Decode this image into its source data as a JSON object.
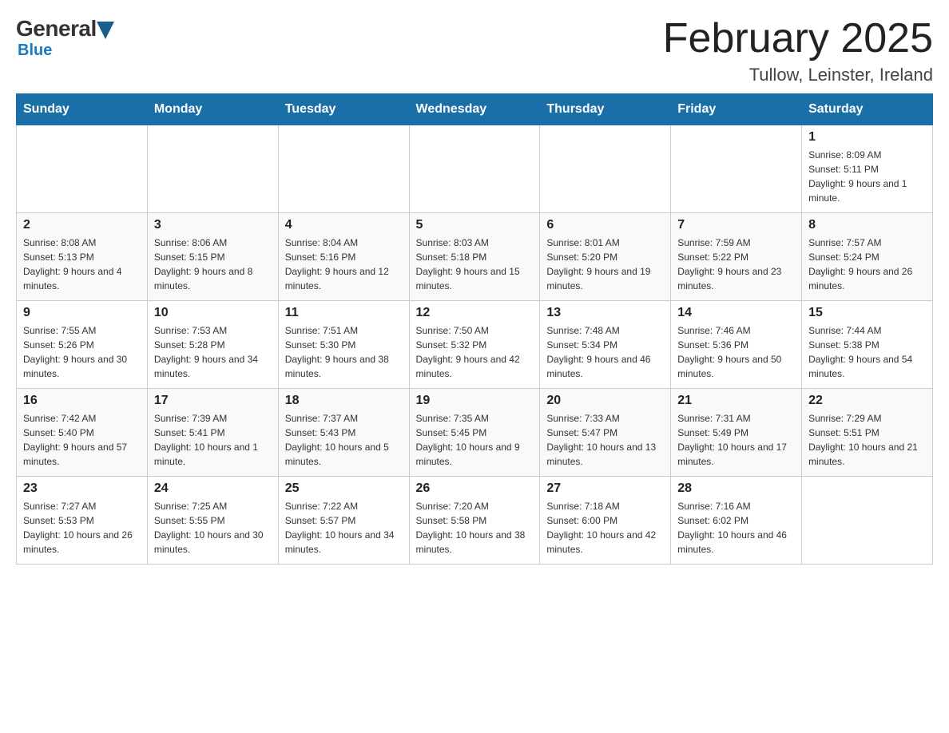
{
  "logo": {
    "general": "General",
    "blue": "Blue"
  },
  "title": "February 2025",
  "location": "Tullow, Leinster, Ireland",
  "days_of_week": [
    "Sunday",
    "Monday",
    "Tuesday",
    "Wednesday",
    "Thursday",
    "Friday",
    "Saturday"
  ],
  "weeks": [
    [
      {
        "day": "",
        "info": ""
      },
      {
        "day": "",
        "info": ""
      },
      {
        "day": "",
        "info": ""
      },
      {
        "day": "",
        "info": ""
      },
      {
        "day": "",
        "info": ""
      },
      {
        "day": "",
        "info": ""
      },
      {
        "day": "1",
        "info": "Sunrise: 8:09 AM\nSunset: 5:11 PM\nDaylight: 9 hours and 1 minute."
      }
    ],
    [
      {
        "day": "2",
        "info": "Sunrise: 8:08 AM\nSunset: 5:13 PM\nDaylight: 9 hours and 4 minutes."
      },
      {
        "day": "3",
        "info": "Sunrise: 8:06 AM\nSunset: 5:15 PM\nDaylight: 9 hours and 8 minutes."
      },
      {
        "day": "4",
        "info": "Sunrise: 8:04 AM\nSunset: 5:16 PM\nDaylight: 9 hours and 12 minutes."
      },
      {
        "day": "5",
        "info": "Sunrise: 8:03 AM\nSunset: 5:18 PM\nDaylight: 9 hours and 15 minutes."
      },
      {
        "day": "6",
        "info": "Sunrise: 8:01 AM\nSunset: 5:20 PM\nDaylight: 9 hours and 19 minutes."
      },
      {
        "day": "7",
        "info": "Sunrise: 7:59 AM\nSunset: 5:22 PM\nDaylight: 9 hours and 23 minutes."
      },
      {
        "day": "8",
        "info": "Sunrise: 7:57 AM\nSunset: 5:24 PM\nDaylight: 9 hours and 26 minutes."
      }
    ],
    [
      {
        "day": "9",
        "info": "Sunrise: 7:55 AM\nSunset: 5:26 PM\nDaylight: 9 hours and 30 minutes."
      },
      {
        "day": "10",
        "info": "Sunrise: 7:53 AM\nSunset: 5:28 PM\nDaylight: 9 hours and 34 minutes."
      },
      {
        "day": "11",
        "info": "Sunrise: 7:51 AM\nSunset: 5:30 PM\nDaylight: 9 hours and 38 minutes."
      },
      {
        "day": "12",
        "info": "Sunrise: 7:50 AM\nSunset: 5:32 PM\nDaylight: 9 hours and 42 minutes."
      },
      {
        "day": "13",
        "info": "Sunrise: 7:48 AM\nSunset: 5:34 PM\nDaylight: 9 hours and 46 minutes."
      },
      {
        "day": "14",
        "info": "Sunrise: 7:46 AM\nSunset: 5:36 PM\nDaylight: 9 hours and 50 minutes."
      },
      {
        "day": "15",
        "info": "Sunrise: 7:44 AM\nSunset: 5:38 PM\nDaylight: 9 hours and 54 minutes."
      }
    ],
    [
      {
        "day": "16",
        "info": "Sunrise: 7:42 AM\nSunset: 5:40 PM\nDaylight: 9 hours and 57 minutes."
      },
      {
        "day": "17",
        "info": "Sunrise: 7:39 AM\nSunset: 5:41 PM\nDaylight: 10 hours and 1 minute."
      },
      {
        "day": "18",
        "info": "Sunrise: 7:37 AM\nSunset: 5:43 PM\nDaylight: 10 hours and 5 minutes."
      },
      {
        "day": "19",
        "info": "Sunrise: 7:35 AM\nSunset: 5:45 PM\nDaylight: 10 hours and 9 minutes."
      },
      {
        "day": "20",
        "info": "Sunrise: 7:33 AM\nSunset: 5:47 PM\nDaylight: 10 hours and 13 minutes."
      },
      {
        "day": "21",
        "info": "Sunrise: 7:31 AM\nSunset: 5:49 PM\nDaylight: 10 hours and 17 minutes."
      },
      {
        "day": "22",
        "info": "Sunrise: 7:29 AM\nSunset: 5:51 PM\nDaylight: 10 hours and 21 minutes."
      }
    ],
    [
      {
        "day": "23",
        "info": "Sunrise: 7:27 AM\nSunset: 5:53 PM\nDaylight: 10 hours and 26 minutes."
      },
      {
        "day": "24",
        "info": "Sunrise: 7:25 AM\nSunset: 5:55 PM\nDaylight: 10 hours and 30 minutes."
      },
      {
        "day": "25",
        "info": "Sunrise: 7:22 AM\nSunset: 5:57 PM\nDaylight: 10 hours and 34 minutes."
      },
      {
        "day": "26",
        "info": "Sunrise: 7:20 AM\nSunset: 5:58 PM\nDaylight: 10 hours and 38 minutes."
      },
      {
        "day": "27",
        "info": "Sunrise: 7:18 AM\nSunset: 6:00 PM\nDaylight: 10 hours and 42 minutes."
      },
      {
        "day": "28",
        "info": "Sunrise: 7:16 AM\nSunset: 6:02 PM\nDaylight: 10 hours and 46 minutes."
      },
      {
        "day": "",
        "info": ""
      }
    ]
  ]
}
